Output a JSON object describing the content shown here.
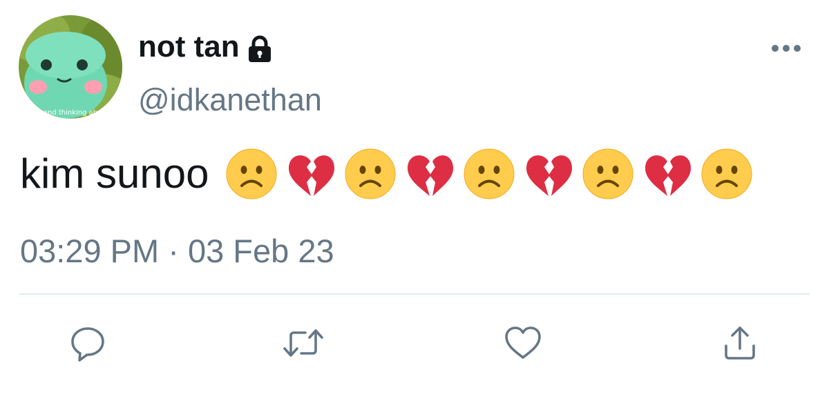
{
  "tweet": {
    "display_name": "not tan",
    "protected_icon": "lock-icon",
    "handle": "@idkanethan",
    "text": "kim sunoo",
    "emojis": [
      "slightly-frowning-face",
      "broken-heart",
      "slightly-frowning-face",
      "broken-heart",
      "slightly-frowning-face",
      "broken-heart",
      "slightly-frowning-face",
      "broken-heart",
      "slightly-frowning-face"
    ],
    "time": "03:29 PM",
    "separator": "·",
    "date": "03 Feb 23",
    "avatar_caption": "and thinking ab"
  },
  "actions": {
    "more": "more-options-icon",
    "reply": "reply-icon",
    "retweet": "retweet-icon",
    "like": "like-icon",
    "share": "share-icon"
  },
  "colors": {
    "text_primary": "#14171a",
    "text_secondary": "#657786",
    "icon": "#657786",
    "divider": "#e1e8ed",
    "broken_heart": "#dd2e44",
    "frown_face": "#ffcc4d"
  }
}
